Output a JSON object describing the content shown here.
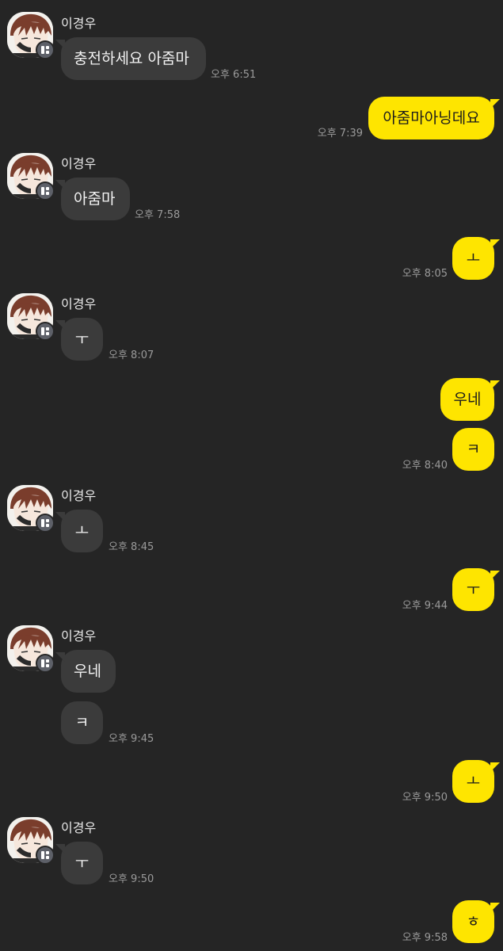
{
  "contact": {
    "name": "이경우"
  },
  "colors": {
    "background": "#252525",
    "incoming_bubble": "#3b3b3b",
    "outgoing_bubble": "#fee500"
  },
  "icons": {
    "avatar": "profile-portrait",
    "badge": "channel-badge-icon"
  },
  "messages": [
    {
      "text": "충전하세요 아줌마",
      "time": "오후 6:51",
      "from": "them"
    },
    {
      "text": "아줌마아닝데요",
      "time": "오후 7:39",
      "from": "me"
    },
    {
      "text": "아줌마",
      "time": "오후 7:58",
      "from": "them"
    },
    {
      "text": "ㅗ",
      "time": "오후 8:05",
      "from": "me"
    },
    {
      "text": "ㅜ",
      "time": "오후 8:07",
      "from": "them"
    },
    {
      "text": "우네",
      "time": "",
      "from": "me"
    },
    {
      "text": "ㅋ",
      "time": "오후 8:40",
      "from": "me"
    },
    {
      "text": "ㅗ",
      "time": "오후 8:45",
      "from": "them"
    },
    {
      "text": "ㅜ",
      "time": "오후 9:44",
      "from": "me"
    },
    {
      "text": "우네",
      "time": "",
      "from": "them"
    },
    {
      "text": "ㅋ",
      "time": "오후 9:45",
      "from": "them"
    },
    {
      "text": "ㅗ",
      "time": "오후 9:50",
      "from": "me"
    },
    {
      "text": "ㅜ",
      "time": "오후 9:50",
      "from": "them"
    },
    {
      "text": "ㅎ",
      "time": "오후 9:58",
      "from": "me"
    }
  ]
}
